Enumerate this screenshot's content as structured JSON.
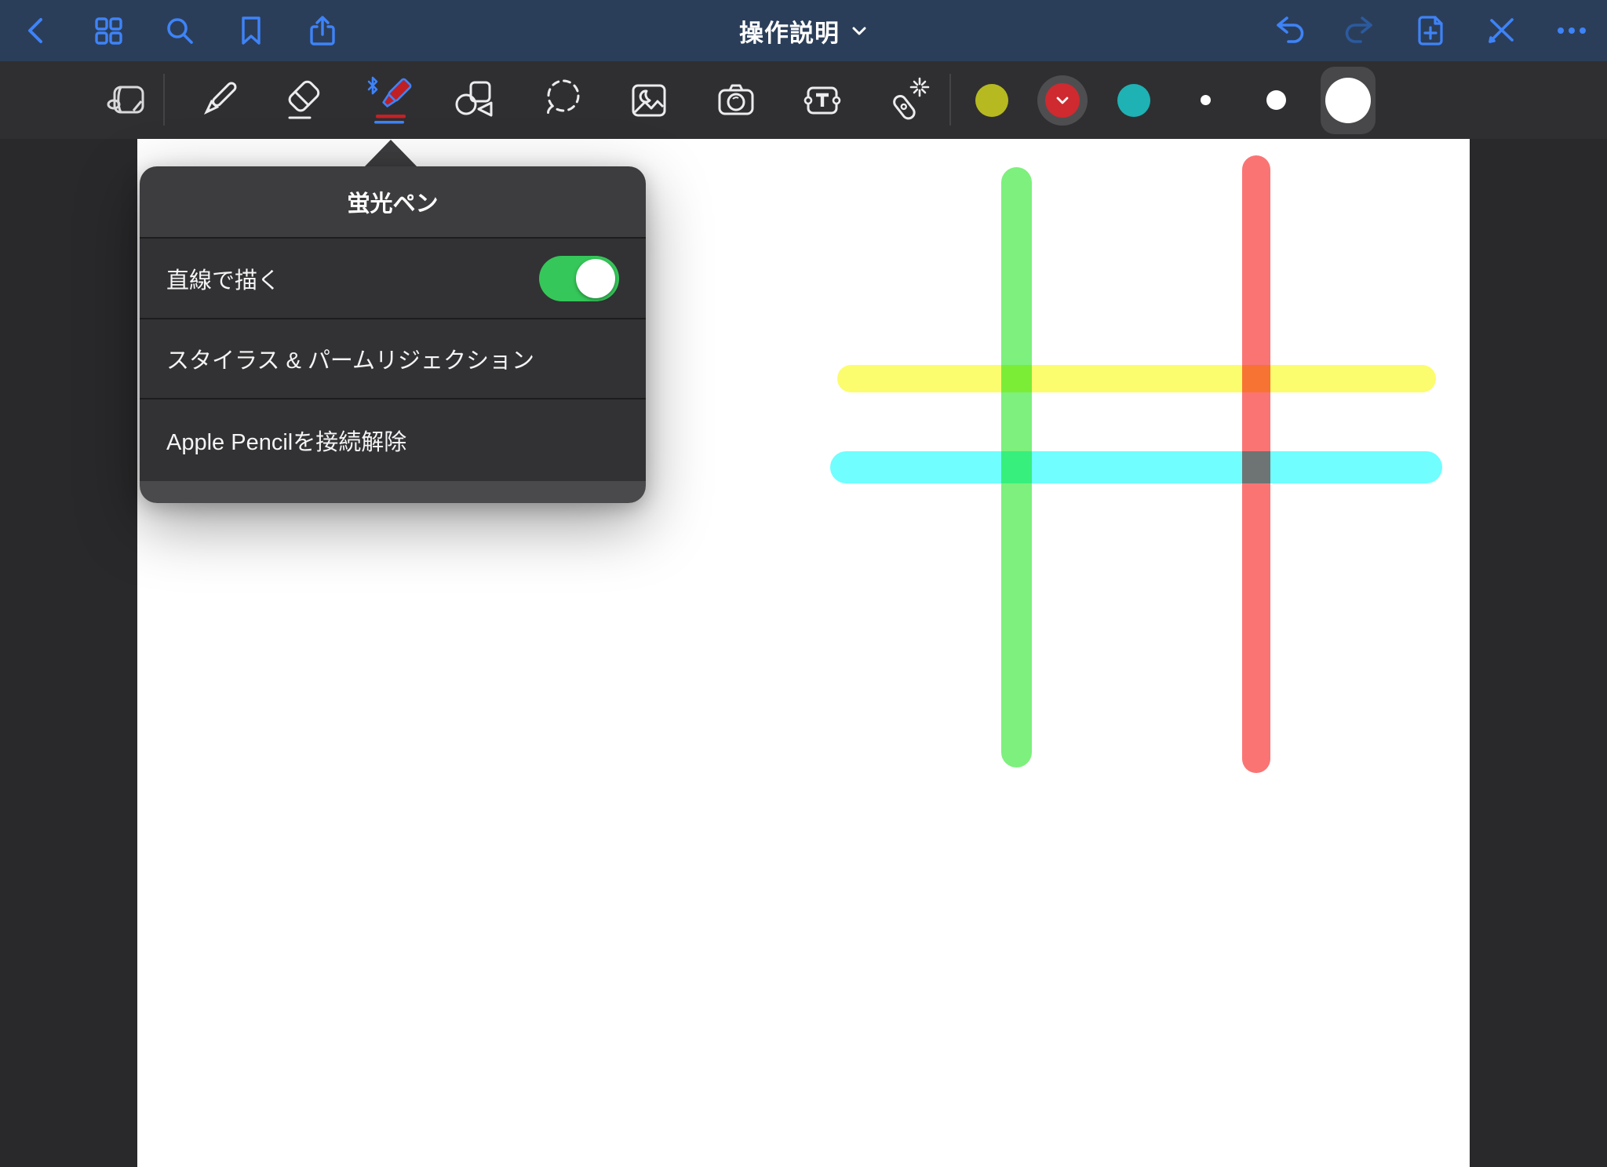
{
  "top_bar": {
    "title": "操作説明",
    "left_icons": [
      "back",
      "thumbnails",
      "search",
      "bookmark",
      "share"
    ],
    "right_icons": [
      "undo",
      "redo",
      "add-page",
      "pencil-disconnect",
      "more"
    ]
  },
  "toolbar": {
    "tools": [
      "view-mode",
      "pen",
      "eraser",
      "highlighter",
      "shapes",
      "lasso",
      "image",
      "camera",
      "text",
      "laser-pointer"
    ],
    "selected_tool": "highlighter",
    "colors": [
      {
        "name": "olive",
        "hex": "#b6ba20",
        "selected": false
      },
      {
        "name": "red",
        "hex": "#ce2a30",
        "selected": true
      },
      {
        "name": "teal",
        "hex": "#1eb2b4",
        "selected": false
      }
    ],
    "sizes": [
      {
        "name": "small",
        "selected": false
      },
      {
        "name": "medium",
        "selected": false
      },
      {
        "name": "large",
        "selected": true
      }
    ]
  },
  "popup": {
    "title": "蛍光ペン",
    "rows": [
      {
        "label": "直線で描く",
        "type": "toggle",
        "value": "on"
      },
      {
        "label": "スタイラス & パームリジェクション",
        "type": "navigation"
      },
      {
        "label": "Apple Pencilを接続解除",
        "type": "action"
      }
    ]
  },
  "canvas": {
    "strokes": [
      {
        "name": "green-vertical",
        "color": "#7df07d"
      },
      {
        "name": "red-vertical",
        "color": "#fa7474"
      },
      {
        "name": "yellow-horizontal",
        "color": "#fcfc6f"
      },
      {
        "name": "cyan-horizontal",
        "color": "#70feff"
      }
    ]
  },
  "theme": {
    "top_bar_bg": "#2b3e59",
    "accent_blue": "#3e83f8",
    "redo_dim_blue": "#2b5a9e",
    "toolbar_bg": "#2f2f31",
    "surround_bg": "#29292c",
    "popup_header_bg": "#3d3d3f",
    "popup_row_bg": "#323234",
    "popup_foot_bg": "#4a4a4c",
    "toggle_on": "#35c759",
    "canvas_bg": "#ffffff"
  }
}
